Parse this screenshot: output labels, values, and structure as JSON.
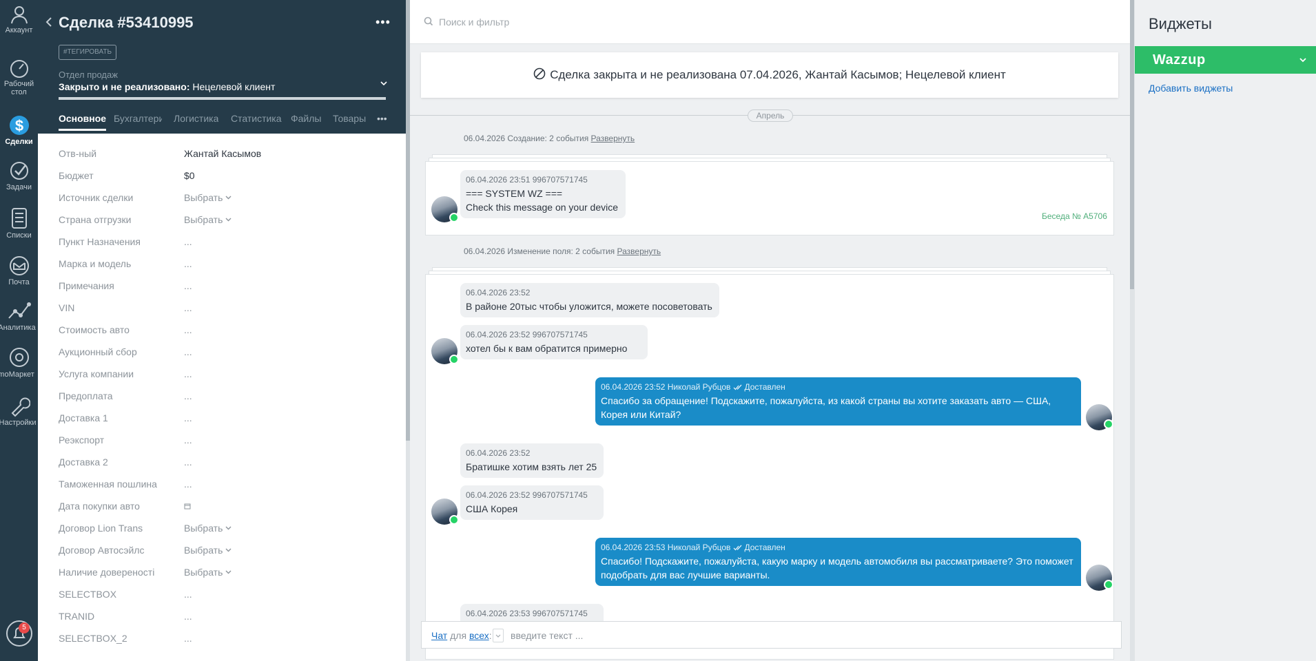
{
  "nav": {
    "items": [
      {
        "label": "Аккаунт",
        "icon": "account-icon"
      },
      {
        "label": "Рабочий стол",
        "icon": "dashboard-icon"
      },
      {
        "label": "Сделки",
        "icon": "deals-icon"
      },
      {
        "label": "Задачи",
        "icon": "tasks-icon"
      },
      {
        "label": "Списки",
        "icon": "lists-icon"
      },
      {
        "label": "Почта",
        "icon": "mail-icon"
      },
      {
        "label": "Аналитика",
        "icon": "analytics-icon"
      },
      {
        "label": "amoМаркет",
        "icon": "market-icon"
      },
      {
        "label": "Настройки",
        "icon": "settings-icon"
      }
    ],
    "notifications_count": "5"
  },
  "card": {
    "title": "Сделка #53410995",
    "tag_button": "#ТЕГИРОВАТЬ",
    "pipeline": "Отдел продаж",
    "status_bold": "Закрыто и не реализовано:",
    "status_reason": "Нецелевой клиент",
    "tabs": [
      "Основное",
      "Бухгалтерия",
      "Логистика",
      "Статистика",
      "Файлы",
      "Товары"
    ],
    "fields": [
      {
        "label": "Отв-ный",
        "value": "Жантай Касымов"
      },
      {
        "label": "Бюджет",
        "value": "$0"
      },
      {
        "label": "Источник сделки",
        "value": "Выбрать"
      },
      {
        "label": "Страна отгрузки",
        "value": "Выбрать"
      },
      {
        "label": "Пункт Назначения",
        "value": "..."
      },
      {
        "label": "Марка и модель",
        "value": "..."
      },
      {
        "label": "Примечания",
        "value": "..."
      },
      {
        "label": "VIN",
        "value": "..."
      },
      {
        "label": "Стоимость авто",
        "value": "..."
      },
      {
        "label": "Аукционный сбор",
        "value": "..."
      },
      {
        "label": "Услуга компании",
        "value": "..."
      },
      {
        "label": "Предоплата",
        "value": "..."
      },
      {
        "label": "Доставка 1",
        "value": "..."
      },
      {
        "label": "Реэкспорт",
        "value": "..."
      },
      {
        "label": "Доставка 2",
        "value": "..."
      },
      {
        "label": "Таможенная пошлина",
        "value": "..."
      },
      {
        "label": "Дата покупки авто",
        "value": ""
      },
      {
        "label": "Договор Lion Trans",
        "value": "Выбрать"
      },
      {
        "label": "Договор Автосэйлс",
        "value": "Выбрать"
      },
      {
        "label": "Наличие довереності",
        "value": "Выбрать"
      },
      {
        "label": "SELECTBOX",
        "value": "..."
      },
      {
        "label": "TRANID",
        "value": "..."
      },
      {
        "label": "SELECTBOX_2",
        "value": "..."
      }
    ]
  },
  "feed": {
    "search_placeholder": "Поиск и фильтр",
    "closed_banner": "Сделка закрыта и не реализована 07.04.2026, Жантай Касымов; Нецелевой клиент",
    "month": "Апрель",
    "event1_text": "06.04.2026 Создание: 2 события",
    "event2_text": "06.04.2026 Изменение поля: 2 события",
    "expand_label": "Развернуть",
    "conversation_link": "Беседа № A5706",
    "messages": [
      {
        "meta": "06.04.2026 23:51 996707571745",
        "line1": "=== SYSTEM WZ ===",
        "line2": "Check this message on your device"
      },
      {
        "meta": "06.04.2026 23:52",
        "text": "В районе 20тыс чтобы уложится, можете посоветовать"
      },
      {
        "meta": "06.04.2026 23:52 996707571745",
        "text": "хотел бы к вам обратится примерно"
      },
      {
        "meta": "06.04.2026 23:52 Николай Рубцов",
        "status": "Доставлен",
        "line1": "Спасибо за обращение! Подскажите, пожалуйста, из какой страны вы хотите заказать авто — США,",
        "line2": "Корея или Китай?"
      },
      {
        "meta": "06.04.2026 23:52",
        "text": "Братишке хотим взять лет 25"
      },
      {
        "meta": "06.04.2026 23:52 996707571745",
        "text": "США Корея"
      },
      {
        "meta": "06.04.2026 23:53 Николай Рубцов",
        "status": "Доставлен",
        "line1": "Спасибо! Подскажите, пожалуйста, какую марку и модель автомобиля вы рассматриваете? Это поможет",
        "line2": "подобрать для вас лучшие варианты."
      },
      {
        "meta": "06.04.2026 23:53 996707571745"
      }
    ],
    "chat_input": {
      "chat_link": "Чат",
      "for": "для",
      "all_link": "всех",
      "colon": ":",
      "placeholder": "введите текст ..."
    }
  },
  "widgets": {
    "title": "Виджеты",
    "wazzup": "Wazzup",
    "add": "Добавить виджеты"
  },
  "colors": {
    "nav_bg": "#253b49",
    "accent_blue": "#1a8cc8",
    "wazzup_green": "#2dbd68",
    "whatsapp_green": "#25d366"
  }
}
